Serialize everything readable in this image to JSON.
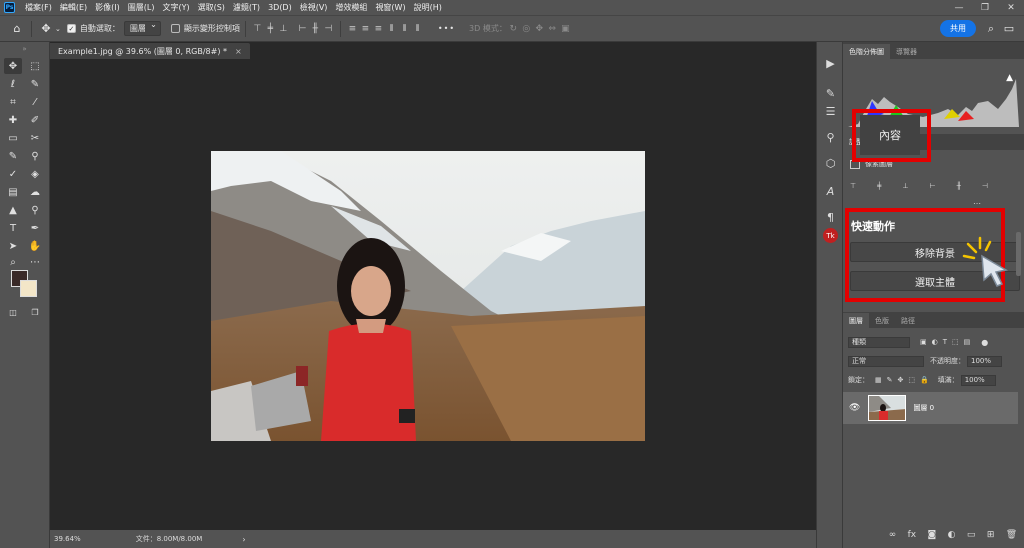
{
  "app": {
    "logo": "Ps"
  },
  "menu": [
    "檔案(F)",
    "編輯(E)",
    "影像(I)",
    "圖層(L)",
    "文字(Y)",
    "選取(S)",
    "濾鏡(T)",
    "3D(D)",
    "檢視(V)",
    "增效模組",
    "視窗(W)",
    "說明(H)"
  ],
  "window_controls": [
    "—",
    "❐",
    "✕"
  ],
  "options": {
    "auto_select_label": "自動選取：",
    "auto_select_value": "圖層",
    "transform_label": "顯示變形控制項",
    "more": "•••",
    "mode_3d": "3D 模式：",
    "share": "共用"
  },
  "document_tab": {
    "title": "Example1.jpg @ 39.6% (圖層 0, RGB/8#) *",
    "close": "×"
  },
  "status": {
    "zoom": "39.64%",
    "docinfo": "文件：8.00M/8.00M",
    "arrow": "›"
  },
  "panels": {
    "histogram_tabs": [
      "色階分佈圖",
      "導覽器"
    ],
    "adjust_tab": "調整",
    "props_label": "像素圖層",
    "content_tab": "內容",
    "quick_actions_title": "快速動作",
    "remove_bg": "移除背景",
    "select_subject": "選取主體"
  },
  "layers": {
    "tabs": [
      "圖層",
      "色版",
      "路徑"
    ],
    "kind": "種類",
    "blend": "正常",
    "opacity_label": "不透明度：",
    "opacity": "100%",
    "lock_label": "鎖定：",
    "fill_label": "填滿：",
    "fill": "100%",
    "layer_name": "圖層 0"
  },
  "colors": {
    "accent": "#1473e6",
    "highlight": "#e30000"
  }
}
